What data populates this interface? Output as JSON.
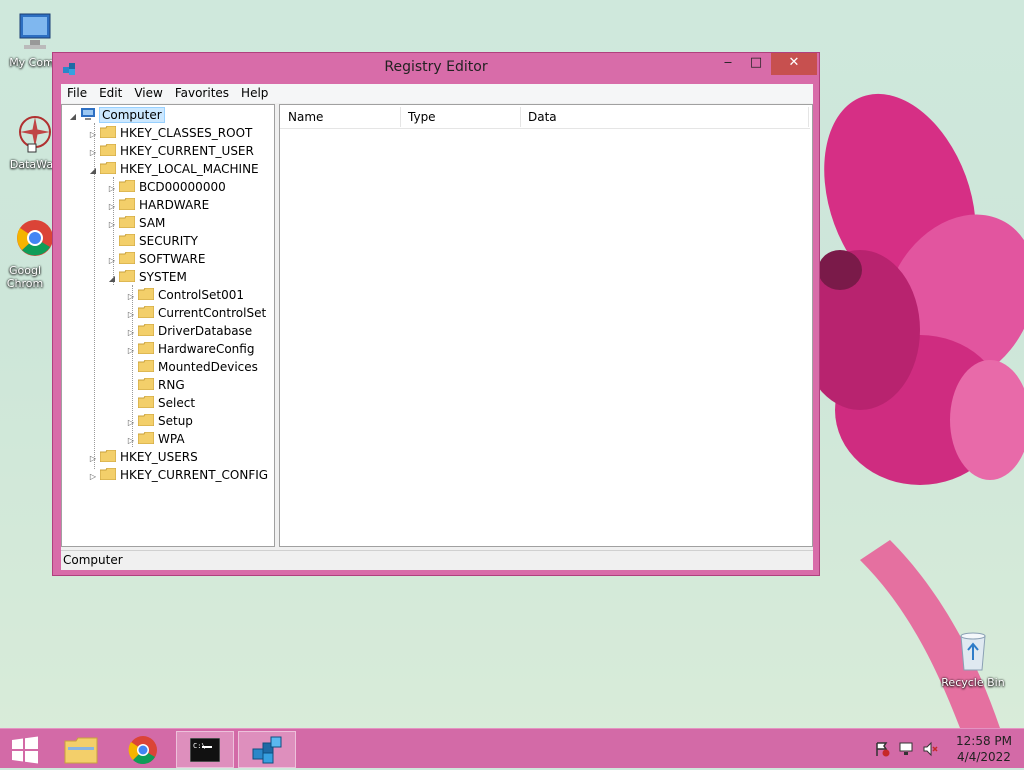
{
  "desktop": {
    "icons": [
      {
        "label": "My Comp"
      },
      {
        "label": "DataWag"
      },
      {
        "label": "Googl Chrom"
      },
      {
        "label": "Recycle Bin"
      }
    ]
  },
  "window": {
    "title": "Registry Editor",
    "controls": {
      "minimize": "‒",
      "maximize": "□",
      "close": "✕"
    },
    "menu": [
      "File",
      "Edit",
      "View",
      "Favorites",
      "Help"
    ],
    "tree": {
      "root": "Computer",
      "hives": [
        "HKEY_CLASSES_ROOT",
        "HKEY_CURRENT_USER",
        "HKEY_LOCAL_MACHINE"
      ],
      "hklm_children": [
        "BCD00000000",
        "HARDWARE",
        "SAM",
        "SECURITY",
        "SOFTWARE",
        "SYSTEM"
      ],
      "system_children": [
        "ControlSet001",
        "CurrentControlSet",
        "DriverDatabase",
        "HardwareConfig",
        "MountedDevices",
        "RNG",
        "Select",
        "Setup",
        "WPA"
      ],
      "more_hives": [
        "HKEY_USERS",
        "HKEY_CURRENT_CONFIG"
      ]
    },
    "columns": [
      "Name",
      "Type",
      "Data"
    ],
    "status": "Computer"
  },
  "taskbar": {
    "clock_time": "12:58 PM",
    "clock_date": "4/4/2022"
  },
  "colors": {
    "window_frame": "#d86ca9",
    "taskbar": "#d36aa7",
    "close_button": "#c7504f",
    "selection": "#cce8ff"
  }
}
